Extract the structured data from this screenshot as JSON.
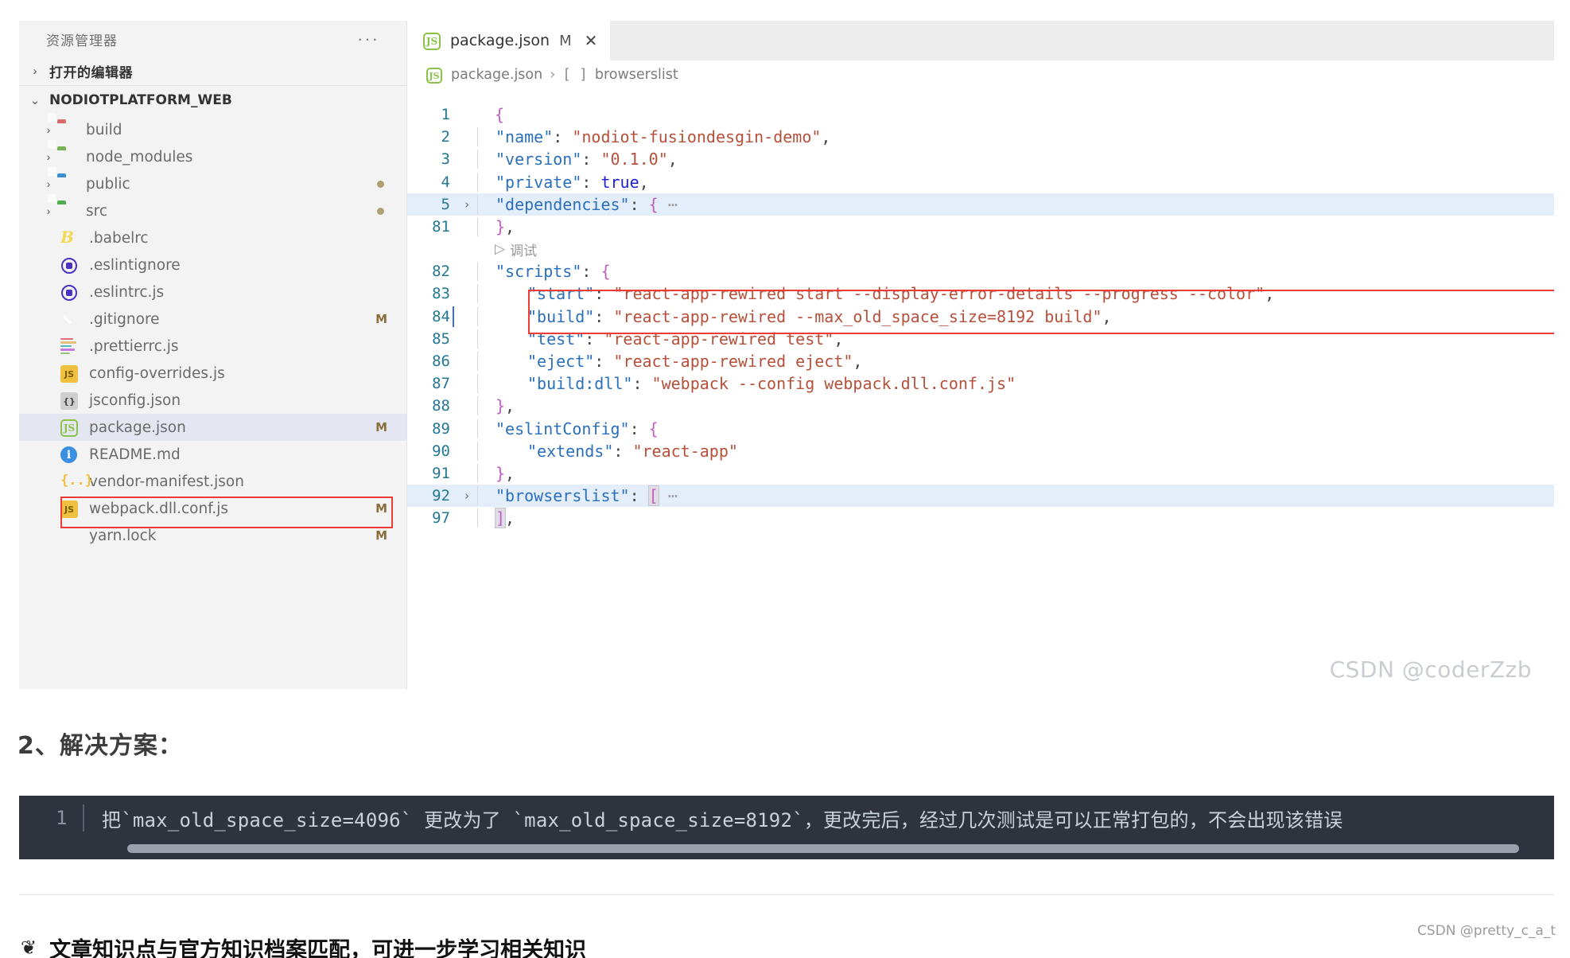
{
  "sidebar": {
    "title": "资源管理器",
    "more_label": "···",
    "open_editors_label": "打开的编辑器",
    "project_label": "NODIOTPLATFORM_WEB",
    "items": [
      {
        "label": "build",
        "icon": "folder-red-icon",
        "kind": "folder",
        "indent": 1,
        "chevron": "›",
        "badge": "",
        "dot": false,
        "selected": false
      },
      {
        "label": "node_modules",
        "icon": "folder-green-icon",
        "kind": "folder",
        "indent": 1,
        "chevron": "›",
        "badge": "",
        "dot": false,
        "selected": false
      },
      {
        "label": "public",
        "icon": "folder-blue-icon",
        "kind": "folder",
        "indent": 1,
        "chevron": "›",
        "badge": "",
        "dot": true,
        "selected": false
      },
      {
        "label": "src",
        "icon": "folder-src-icon",
        "kind": "folder",
        "indent": 1,
        "chevron": "›",
        "badge": "",
        "dot": true,
        "selected": false
      },
      {
        "label": ".babelrc",
        "icon": "babel-icon",
        "kind": "file",
        "indent": 2,
        "chevron": "",
        "badge": "",
        "dot": false,
        "selected": false
      },
      {
        "label": ".eslintignore",
        "icon": "eslint-icon",
        "kind": "file",
        "indent": 2,
        "chevron": "",
        "badge": "",
        "dot": false,
        "selected": false
      },
      {
        "label": ".eslintrc.js",
        "icon": "eslint-icon",
        "kind": "file",
        "indent": 2,
        "chevron": "",
        "badge": "",
        "dot": false,
        "selected": false
      },
      {
        "label": ".gitignore",
        "icon": "git-icon",
        "kind": "file",
        "indent": 2,
        "chevron": "",
        "badge": "M",
        "dot": false,
        "selected": false
      },
      {
        "label": ".prettierrc.js",
        "icon": "prettier-icon",
        "kind": "file",
        "indent": 2,
        "chevron": "",
        "badge": "",
        "dot": false,
        "selected": false
      },
      {
        "label": "config-overrides.js",
        "icon": "javascript-icon",
        "kind": "file",
        "indent": 2,
        "chevron": "",
        "badge": "",
        "dot": false,
        "selected": false
      },
      {
        "label": "jsconfig.json",
        "icon": "jsconfig-icon",
        "kind": "file",
        "indent": 2,
        "chevron": "",
        "badge": "",
        "dot": false,
        "selected": false
      },
      {
        "label": "package.json",
        "icon": "nodejs-icon",
        "kind": "file",
        "indent": 2,
        "chevron": "",
        "badge": "M",
        "dot": false,
        "selected": true
      },
      {
        "label": "README.md",
        "icon": "markdown-info-icon",
        "kind": "file",
        "indent": 2,
        "chevron": "",
        "badge": "",
        "dot": false,
        "selected": false
      },
      {
        "label": "vendor-manifest.json",
        "icon": "json-braces-icon",
        "kind": "file",
        "indent": 2,
        "chevron": "",
        "badge": "",
        "dot": false,
        "selected": false
      },
      {
        "label": "webpack.dll.conf.js",
        "icon": "javascript-icon",
        "kind": "file",
        "indent": 2,
        "chevron": "",
        "badge": "M",
        "dot": false,
        "selected": false
      },
      {
        "label": "yarn.lock",
        "icon": "yarn-icon",
        "kind": "file",
        "indent": 2,
        "chevron": "",
        "badge": "M",
        "dot": false,
        "selected": false
      }
    ]
  },
  "editor": {
    "tab": {
      "label": "package.json",
      "modified_marker": "M",
      "close_label": "✕"
    },
    "breadcrumb": {
      "file": "package.json",
      "separator": "›",
      "bracket": "[ ]",
      "node": "browserslist"
    },
    "codelens_label": "调试",
    "codelens_icon": "play-triangle-icon",
    "watermark": "CSDN @coderZzb",
    "lines": [
      {
        "n": "1",
        "fold": "",
        "indent": 0,
        "highlight": false,
        "tokens": [
          {
            "t": "{",
            "c": "p"
          }
        ]
      },
      {
        "n": "2",
        "fold": "",
        "indent": 1,
        "highlight": false,
        "tokens": [
          {
            "t": "\"name\"",
            "c": "k"
          },
          {
            "t": ": ",
            "c": "pl"
          },
          {
            "t": "\"nodiot-fusiondesgin-demo\"",
            "c": "s"
          },
          {
            "t": ",",
            "c": "pl"
          }
        ]
      },
      {
        "n": "3",
        "fold": "",
        "indent": 1,
        "highlight": false,
        "tokens": [
          {
            "t": "\"version\"",
            "c": "k"
          },
          {
            "t": ": ",
            "c": "pl"
          },
          {
            "t": "\"0.1.0\"",
            "c": "s"
          },
          {
            "t": ",",
            "c": "pl"
          }
        ]
      },
      {
        "n": "4",
        "fold": "",
        "indent": 1,
        "highlight": false,
        "tokens": [
          {
            "t": "\"private\"",
            "c": "k"
          },
          {
            "t": ": ",
            "c": "pl"
          },
          {
            "t": "true",
            "c": "b"
          },
          {
            "t": ",",
            "c": "pl"
          }
        ]
      },
      {
        "n": "5",
        "fold": "›",
        "indent": 1,
        "highlight": true,
        "tokens": [
          {
            "t": "\"dependencies\"",
            "c": "k"
          },
          {
            "t": ": ",
            "c": "pl"
          },
          {
            "t": "{",
            "c": "p"
          },
          {
            "t": " ⋯",
            "c": "elip"
          }
        ]
      },
      {
        "n": "81",
        "fold": "",
        "indent": 1,
        "highlight": false,
        "tokens": [
          {
            "t": "}",
            "c": "p"
          },
          {
            "t": ",",
            "c": "pl"
          }
        ]
      },
      {
        "n": "82",
        "fold": "",
        "indent": 1,
        "highlight": false,
        "tokens": [
          {
            "t": "\"scripts\"",
            "c": "k"
          },
          {
            "t": ": ",
            "c": "pl"
          },
          {
            "t": "{",
            "c": "p"
          }
        ]
      },
      {
        "n": "83",
        "fold": "",
        "indent": 2,
        "highlight": false,
        "tokens": [
          {
            "t": "\"start\"",
            "c": "k"
          },
          {
            "t": ": ",
            "c": "pl"
          },
          {
            "t": "\"react-app-rewired start --display-error-details --progress --color\"",
            "c": "s"
          },
          {
            "t": ",",
            "c": "pl"
          }
        ]
      },
      {
        "n": "84",
        "fold": "",
        "indent": 2,
        "highlight": false,
        "cursor": true,
        "tokens": [
          {
            "t": "\"build\"",
            "c": "k"
          },
          {
            "t": ": ",
            "c": "pl"
          },
          {
            "t": "\"react-app-rewired --max_old_space_size=8192 build\"",
            "c": "s"
          },
          {
            "t": ",",
            "c": "pl"
          }
        ]
      },
      {
        "n": "85",
        "fold": "",
        "indent": 2,
        "highlight": false,
        "tokens": [
          {
            "t": "\"test\"",
            "c": "k"
          },
          {
            "t": ": ",
            "c": "pl"
          },
          {
            "t": "\"react-app-rewired test\"",
            "c": "s"
          },
          {
            "t": ",",
            "c": "pl"
          }
        ]
      },
      {
        "n": "86",
        "fold": "",
        "indent": 2,
        "highlight": false,
        "tokens": [
          {
            "t": "\"eject\"",
            "c": "k"
          },
          {
            "t": ": ",
            "c": "pl"
          },
          {
            "t": "\"react-app-rewired eject\"",
            "c": "s"
          },
          {
            "t": ",",
            "c": "pl"
          }
        ]
      },
      {
        "n": "87",
        "fold": "",
        "indent": 2,
        "highlight": false,
        "tokens": [
          {
            "t": "\"build:dll\"",
            "c": "k"
          },
          {
            "t": ": ",
            "c": "pl"
          },
          {
            "t": "\"webpack --config webpack.dll.conf.js\"",
            "c": "s"
          }
        ]
      },
      {
        "n": "88",
        "fold": "",
        "indent": 1,
        "highlight": false,
        "tokens": [
          {
            "t": "}",
            "c": "p"
          },
          {
            "t": ",",
            "c": "pl"
          }
        ]
      },
      {
        "n": "89",
        "fold": "",
        "indent": 1,
        "highlight": false,
        "tokens": [
          {
            "t": "\"eslintConfig\"",
            "c": "k"
          },
          {
            "t": ": ",
            "c": "pl"
          },
          {
            "t": "{",
            "c": "p"
          }
        ]
      },
      {
        "n": "90",
        "fold": "",
        "indent": 2,
        "highlight": false,
        "tokens": [
          {
            "t": "\"extends\"",
            "c": "k"
          },
          {
            "t": ": ",
            "c": "pl"
          },
          {
            "t": "\"react-app\"",
            "c": "s"
          }
        ]
      },
      {
        "n": "91",
        "fold": "",
        "indent": 1,
        "highlight": false,
        "tokens": [
          {
            "t": "}",
            "c": "p"
          },
          {
            "t": ",",
            "c": "pl"
          }
        ]
      },
      {
        "n": "92",
        "fold": "›",
        "indent": 1,
        "highlight": true,
        "tokens": [
          {
            "t": "\"browserslist\"",
            "c": "k"
          },
          {
            "t": ": ",
            "c": "pl"
          },
          {
            "t": "[",
            "c": "p",
            "bracket": true
          },
          {
            "t": " ⋯",
            "c": "elip"
          }
        ]
      },
      {
        "n": "97",
        "fold": "",
        "indent": 1,
        "highlight": false,
        "tokens": [
          {
            "t": "]",
            "c": "p",
            "bracket": true
          },
          {
            "t": ",",
            "c": "pl"
          }
        ]
      }
    ]
  },
  "article": {
    "heading": "2、解决方案：",
    "codeblock": {
      "line_number": "1",
      "text": "把`max_old_space_size=4096` 更改为了 `max_old_space_size=8192`，更改完后，经过几次测试是可以正常打包的，不会出现该错误"
    },
    "footer": {
      "icon": "leaf-icon",
      "text": "文章知识点与官方知识档案匹配，可进一步学习相关知识"
    },
    "watermark": "CSDN @pretty_c_a_t"
  },
  "colors": {
    "accent_red": "#ee3b35",
    "selection_blue": "#e4eefb",
    "sidebar_bg": "#f3f3f3",
    "codeblock_bg": "#2f333d"
  }
}
